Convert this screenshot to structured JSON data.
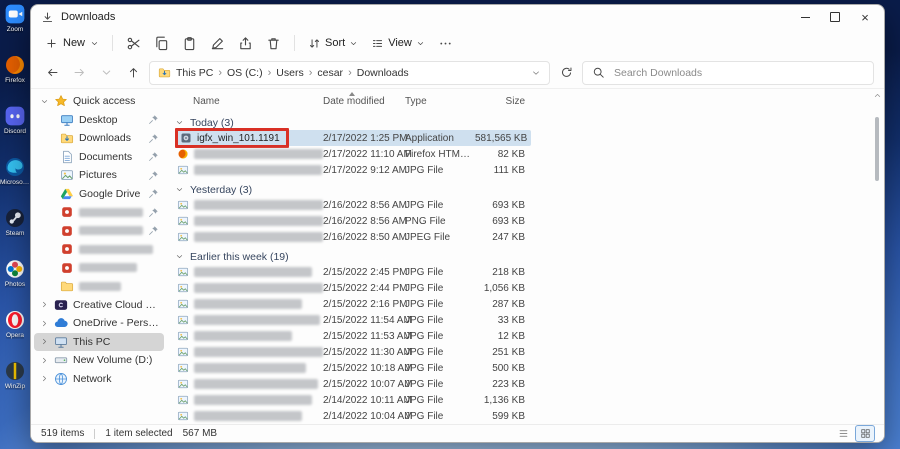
{
  "desktop": {
    "icons": [
      {
        "icon": "zoom",
        "label": "Zoom"
      },
      {
        "icon": "firefoxapp",
        "label": "Firefox"
      },
      {
        "icon": "discord",
        "label": "Discord"
      },
      {
        "icon": "edge",
        "label": "Microsoft Edge"
      },
      {
        "icon": "steam",
        "label": "Steam"
      },
      {
        "icon": "photos",
        "label": "Photos"
      },
      {
        "icon": "opera",
        "label": "Opera"
      },
      {
        "icon": "winzip",
        "label": "WinZip"
      }
    ]
  },
  "window": {
    "title": "Downloads",
    "accent_color": "#0067c0",
    "annotation_color": "#d93025",
    "selection_color": "#cfe0ef",
    "toolbar": {
      "new_label": "New",
      "sort_label": "Sort",
      "view_label": "View",
      "icon_buttons": [
        "cut",
        "copy",
        "paste",
        "rename",
        "share",
        "delete"
      ]
    },
    "address": {
      "crumbs": [
        "This PC",
        "OS (C:)",
        "Users",
        "cesar",
        "Downloads"
      ],
      "search_placeholder": "Search Downloads"
    },
    "columns": [
      "Name",
      "Date modified",
      "Type",
      "Size"
    ],
    "sidebar": {
      "items": [
        {
          "label": "Quick access",
          "icon": "star",
          "chevron": "down",
          "level": 0
        },
        {
          "label": "Desktop",
          "icon": "desktop",
          "level": 1,
          "pinned": true
        },
        {
          "label": "Downloads",
          "icon": "downloads",
          "level": 1,
          "pinned": true
        },
        {
          "label": "Documents",
          "icon": "documents",
          "level": 1,
          "pinned": true
        },
        {
          "label": "Pictures",
          "icon": "pictures",
          "level": 1,
          "pinned": true
        },
        {
          "label": "Google Drive",
          "icon": "gdrive",
          "level": 1,
          "pinned": true
        },
        {
          "label": "",
          "blurred": true,
          "icon": "redsq",
          "level": 1,
          "pinned": true
        },
        {
          "label": "",
          "blurred": true,
          "icon": "redsq",
          "level": 1,
          "pinned": true
        },
        {
          "label": "",
          "blurred": true,
          "icon": "redsq",
          "level": 1
        },
        {
          "label": "",
          "blurred": true,
          "icon": "redsq",
          "level": 1
        },
        {
          "label": "",
          "blurred": true,
          "icon": "folder",
          "level": 1
        },
        {
          "label": "Creative Cloud Files",
          "icon": "cc",
          "chevron": "right",
          "level": 0
        },
        {
          "label": "OneDrive - Personal",
          "icon": "cloud",
          "chevron": "right",
          "level": 0
        },
        {
          "label": "This PC",
          "icon": "pc",
          "chevron": "right",
          "level": 0,
          "selected": true
        },
        {
          "label": "New Volume (D:)",
          "icon": "drive",
          "chevron": "right",
          "level": 0
        },
        {
          "label": "Network",
          "icon": "network",
          "chevron": "right",
          "level": 0
        }
      ]
    },
    "groups": [
      {
        "label": "Today (3)",
        "rows": [
          {
            "name": "igfx_win_101.1191",
            "blurred": false,
            "icon": "app",
            "date": "2/17/2022 1:25 PM",
            "type": "Application",
            "size": "581,565 KB",
            "selected": true,
            "annotated": true
          },
          {
            "name": "",
            "blurred": true,
            "icon": "firefoxdoc",
            "date": "2/17/2022 11:10 AM",
            "type": "Firefox HTML Doc...",
            "size": "82 KB"
          },
          {
            "name": "",
            "blurred": true,
            "icon": "image",
            "date": "2/17/2022 9:12 AM",
            "type": "JPG File",
            "size": "111 KB"
          }
        ]
      },
      {
        "label": "Yesterday (3)",
        "rows": [
          {
            "name": "",
            "blurred": true,
            "icon": "image",
            "date": "2/16/2022 8:56 AM",
            "type": "JPG File",
            "size": "693 KB"
          },
          {
            "name": "",
            "blurred": true,
            "icon": "image",
            "date": "2/16/2022 8:56 AM",
            "type": "PNG File",
            "size": "693 KB"
          },
          {
            "name": "",
            "blurred": true,
            "icon": "image",
            "date": "2/16/2022 8:50 AM",
            "type": "JPEG File",
            "size": "247 KB"
          }
        ]
      },
      {
        "label": "Earlier this week (19)",
        "rows": [
          {
            "name": "",
            "blurred": true,
            "icon": "image",
            "date": "2/15/2022 2:45 PM",
            "type": "JPG File",
            "size": "218 KB"
          },
          {
            "name": "",
            "blurred": true,
            "icon": "image",
            "date": "2/15/2022 2:44 PM",
            "type": "JPG File",
            "size": "1,056 KB"
          },
          {
            "name": "",
            "blurred": true,
            "icon": "image",
            "date": "2/15/2022 2:16 PM",
            "type": "JPG File",
            "size": "287 KB"
          },
          {
            "name": "",
            "blurred": true,
            "icon": "image",
            "date": "2/15/2022 11:54 AM",
            "type": "JPG File",
            "size": "33 KB"
          },
          {
            "name": "",
            "blurred": true,
            "icon": "image",
            "date": "2/15/2022 11:53 AM",
            "type": "JPG File",
            "size": "12 KB"
          },
          {
            "name": "",
            "blurred": true,
            "icon": "image",
            "date": "2/15/2022 11:30 AM",
            "type": "JPG File",
            "size": "251 KB"
          },
          {
            "name": "",
            "blurred": true,
            "icon": "image",
            "date": "2/15/2022 10:18 AM",
            "type": "JPG File",
            "size": "500 KB"
          },
          {
            "name": "",
            "blurred": true,
            "icon": "image",
            "date": "2/15/2022 10:07 AM",
            "type": "JPG File",
            "size": "223 KB"
          },
          {
            "name": "",
            "blurred": true,
            "icon": "image",
            "date": "2/14/2022 10:11 AM",
            "type": "JPG File",
            "size": "1,136 KB"
          },
          {
            "name": "",
            "blurred": true,
            "icon": "image",
            "date": "2/14/2022 10:04 AM",
            "type": "JPG File",
            "size": "599 KB"
          }
        ]
      }
    ],
    "statusbar": {
      "items": "519 items",
      "selected": "1 item selected",
      "size": "567 MB"
    }
  }
}
